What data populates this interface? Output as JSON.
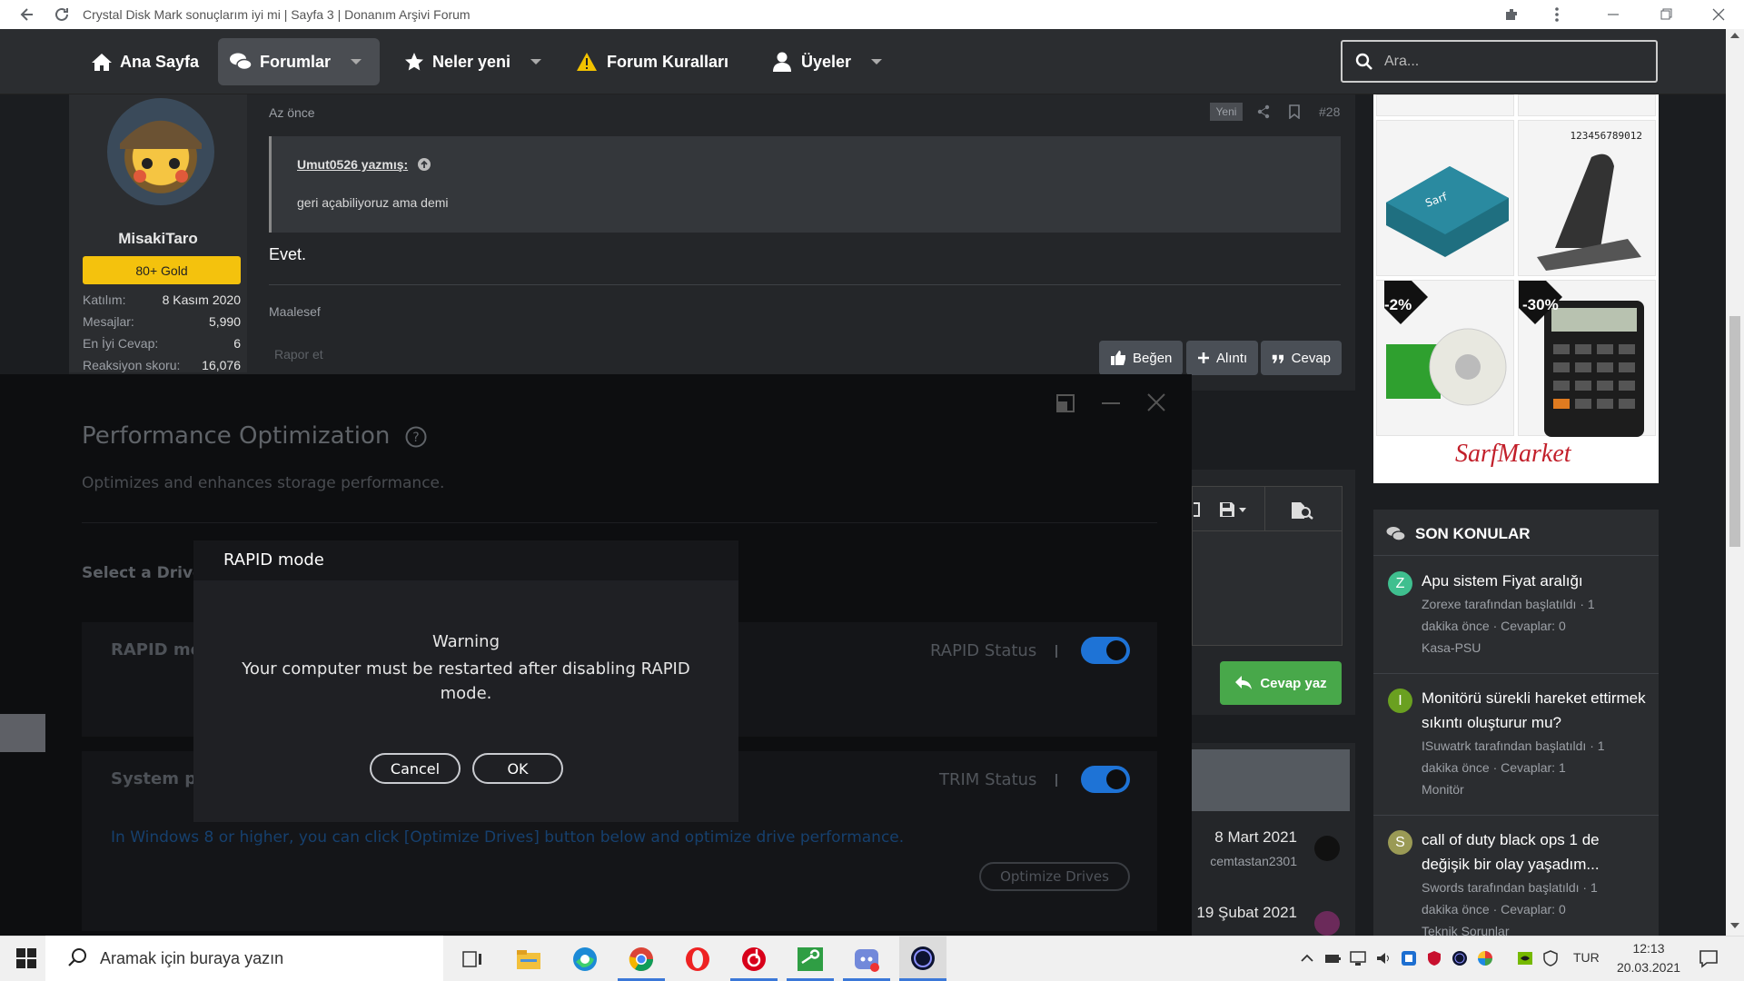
{
  "browser": {
    "tab_title": "Crystal Disk Mark sonuçlarım iyi mi | Sayfa 3 | Donanım Arşivi Forum"
  },
  "nav": {
    "home": "Ana Sayfa",
    "forums": "Forumlar",
    "whats_new": "Neler yeni",
    "rules": "Forum Kuralları",
    "members": "Üyeler",
    "search_placeholder": "Ara..."
  },
  "post": {
    "time": "Az önce",
    "new_badge": "Yeni",
    "number": "#28",
    "user": {
      "name": "MisakiTaro",
      "badge": "80+ Gold",
      "stats": [
        {
          "label": "Katılım:",
          "value": "8 Kasım 2020"
        },
        {
          "label": "Mesajlar:",
          "value": "5,990"
        },
        {
          "label": "En İyi Cevap:",
          "value": "6"
        },
        {
          "label": "Reaksiyon skoru:",
          "value": "16,076"
        }
      ]
    },
    "quote_author": "Umut0526 yazmış:",
    "quote_text": "geri açabiliyoruz ama demi",
    "body": "Evet.",
    "signature": "Maalesef",
    "report": "Rapor et",
    "actions": {
      "like": "Beğen",
      "quote": "Alıntı",
      "reply": "Cevap"
    }
  },
  "ads": {
    "discount1": "-2%",
    "discount2": "-30%",
    "brand": "SarfMarket",
    "calc_display": "123456789012"
  },
  "recent": {
    "title": "SON KONULAR",
    "items": [
      {
        "initial": "Z",
        "color": "#3fbf8f",
        "title": "Apu sistem Fiyat aralığı",
        "meta1": "Zorexe tarafından başlatıldı · 1",
        "meta2": "dakika önce · Cevaplar: 0",
        "forum": "Kasa-PSU"
      },
      {
        "initial": "I",
        "color": "#6aa020",
        "title": "Monitörü sürekli hareket ettirmek sıkıntı oluşturur mu?",
        "meta1": "ISuwatrk tarafından başlatıldı · 1",
        "meta2": "dakika önce · Cevaplar: 1",
        "forum": "Monitör"
      },
      {
        "initial": "S",
        "color": "#9a9a55",
        "title": "call of duty black ops 1 de değişik bir olay yaşadım...",
        "meta1": "Swords tarafından başlatıldı · 1",
        "meta2": "dakika önce · Cevaplar: 0",
        "forum": "Teknik Sorunlar"
      }
    ]
  },
  "thread_list": {
    "reply_button": "Cevap yaz",
    "rows": [
      {
        "date": "8 Mart 2021",
        "user": "cemtastan2301"
      },
      {
        "date": "19 Şubat 2021",
        "user": ""
      }
    ]
  },
  "magician": {
    "title": "Performance Optimization",
    "subtitle": "Optimizes and enhances storage performance.",
    "select_drive": "Select a Drive",
    "rapid_label": "RAPID mo",
    "rapid_status": "RAPID Status",
    "system_label": "System pe",
    "trim_status": "TRIM Status",
    "hint": "In Windows 8 or higher, you can click [Optimize Drives] button below and optimize drive performance.",
    "optimize_button": "Optimize Drives"
  },
  "modal": {
    "title": "RAPID mode",
    "warning": "Warning",
    "message": "Your computer must be restarted after disabling RAPID mode.",
    "cancel": "Cancel",
    "ok": "OK"
  },
  "taskbar": {
    "search_placeholder": "Aramak için buraya yazın",
    "language": "TUR",
    "time": "12:13",
    "date": "20.03.2021"
  },
  "colors": {
    "accent_blue": "#1e73d6",
    "forum_bg": "#242629",
    "gold_badge": "#f4c20d",
    "reply_green": "#48a84a"
  }
}
